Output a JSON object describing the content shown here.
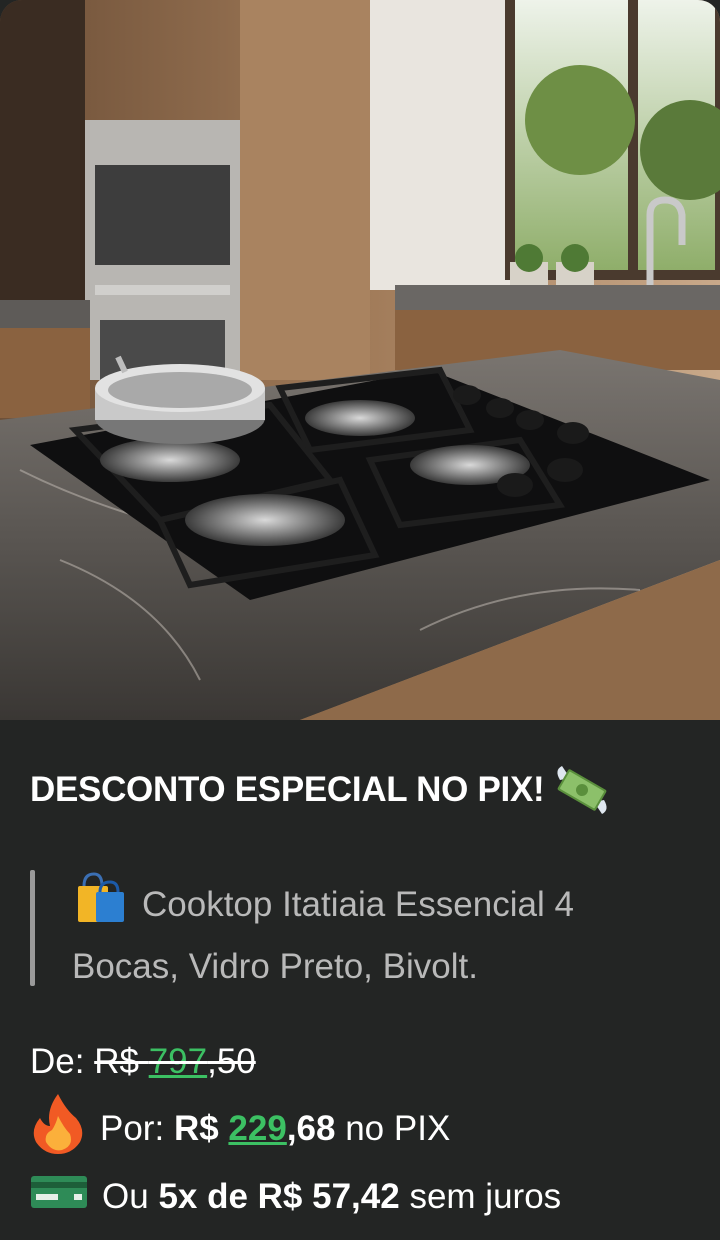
{
  "photo": {
    "alt_icon": "cooktop-photo"
  },
  "headline": {
    "text": "DESCONTO ESPECIAL NO PIX!",
    "emoji": "flying-money-icon"
  },
  "quote": {
    "emoji": "shopping-bags-icon",
    "text": "Cooktop Itatiaia Essencial 4 Bocas, Vidro Preto, Bivolt."
  },
  "price_from": {
    "label": "De:",
    "currency": "R$",
    "whole": "797",
    "cents": ",50"
  },
  "price_pix": {
    "emoji": "fire-icon",
    "label": "Por:",
    "currency": "R$",
    "whole": "229",
    "cents": ",68",
    "suffix": "no PIX"
  },
  "installments": {
    "emoji": "credit-card-icon",
    "prefix": "Ou",
    "bold": "5x de R$ 57,42",
    "suffix": "sem juros"
  },
  "colors": {
    "background": "#232524",
    "accent_green": "#3cc063",
    "quote_text": "#b9b9b9"
  }
}
